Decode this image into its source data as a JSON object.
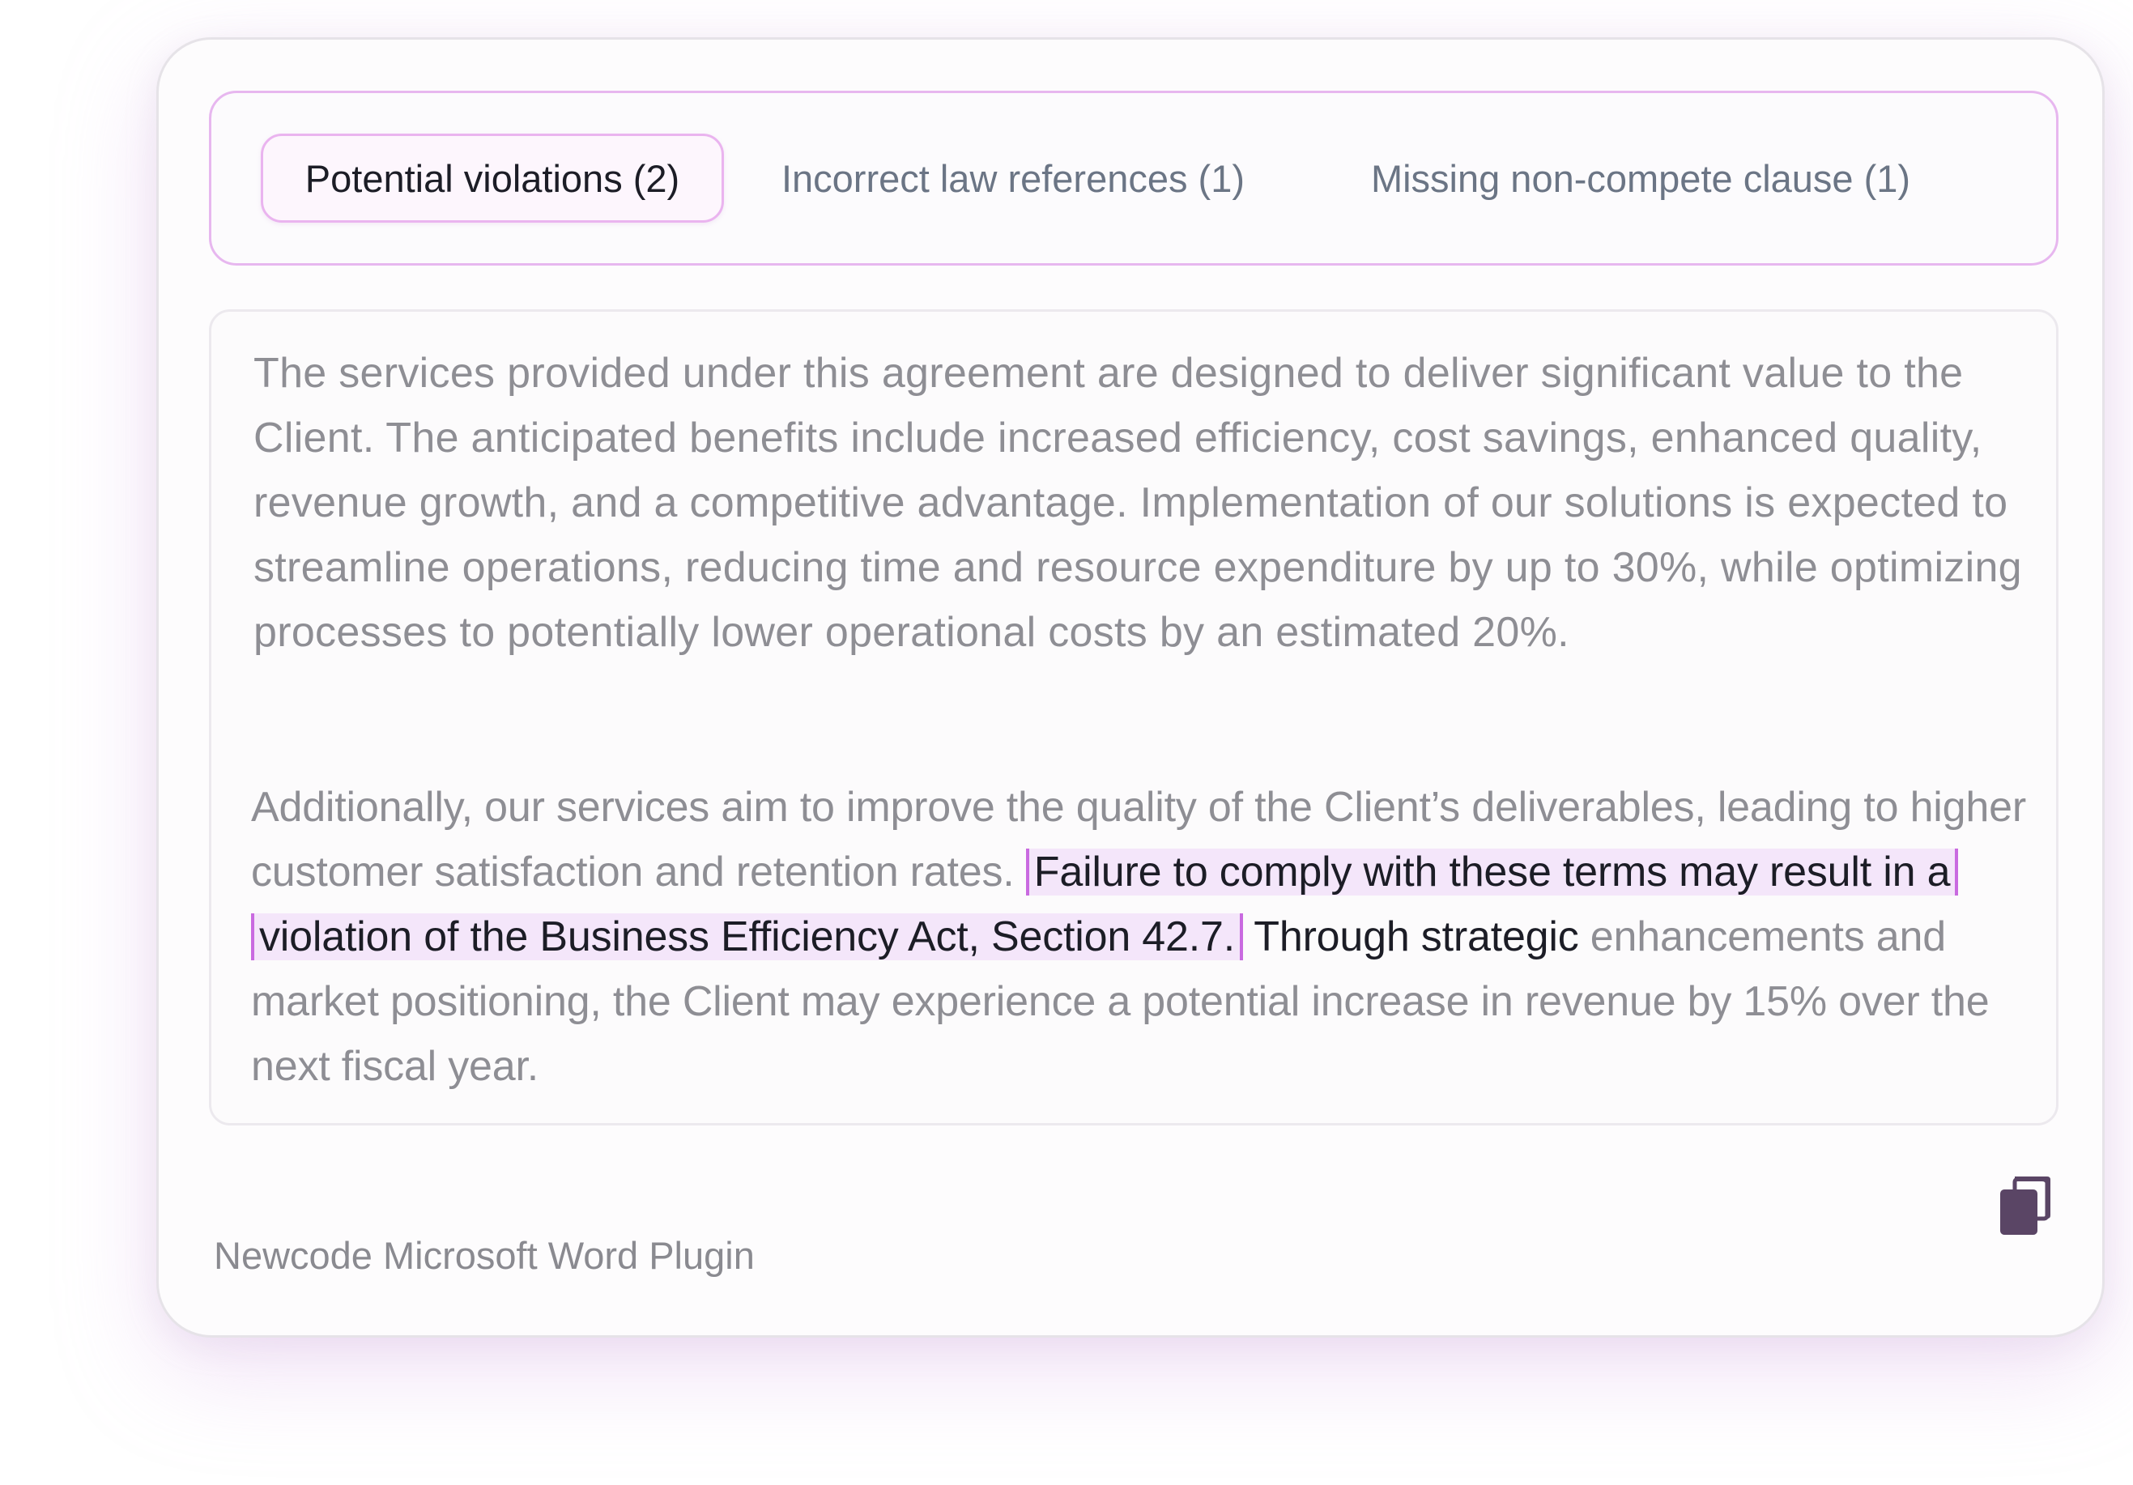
{
  "tabs": [
    {
      "label": "Potential violations (2)",
      "active": true
    },
    {
      "label": "Incorrect law references (1)",
      "active": false
    },
    {
      "label": "Missing non-compete clause (1)",
      "active": false
    }
  ],
  "document": {
    "paragraph_1": "The services provided under this agreement are designed to deliver significant value to the Client. The anticipated benefits include increased efficiency, cost savings, enhanced quality, revenue growth, and a competitive advantage. Implementation of our solutions is expected to streamline operations, reducing time and resource expenditure by up to 30%, while optimizing processes to potentially lower operational costs by an estimated 20%.",
    "paragraph_2_before": "Additionally, our services aim to improve the quality of the Client’s deliverables, leading to higher customer satisfaction and retention rates.",
    "paragraph_2_highlight": "Failure to comply with these terms may result in a violation of the Business Efficiency Act, Section 42.7.",
    "paragraph_2_dark": "Through strategic",
    "paragraph_2_after": "enhancements and market positioning, the Client may experience a potential increase in revenue by 15% over the next fiscal year."
  },
  "footer": {
    "label": "Newcode Microsoft Word Plugin"
  },
  "icons": {
    "copy": "copy-icon"
  },
  "colors": {
    "accent": "#c96ae0",
    "highlight_bg": "#f4e6fa",
    "icon": "#5a4565",
    "muted_text": "#8e8e94",
    "dark_text": "#1c1d26"
  }
}
